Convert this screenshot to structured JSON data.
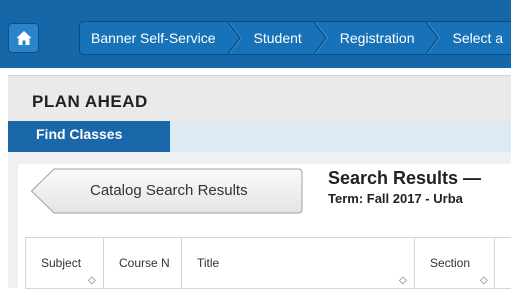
{
  "topbar": {
    "breadcrumbs": [
      "Banner Self-Service",
      "Student",
      "Registration",
      "Select a"
    ]
  },
  "page_title": "PLAN AHEAD",
  "tabs": [
    {
      "label": "Find Classes",
      "active": true
    }
  ],
  "back_button": {
    "label": "Catalog Search Results"
  },
  "results": {
    "title": "Search Results —",
    "term": "Term: Fall 2017 - Urba"
  },
  "table": {
    "headers": [
      "Subject",
      "Course N",
      "Title",
      "Section"
    ]
  },
  "colors": {
    "topbar": "#1667a8",
    "tab_active": "#1a67aa",
    "tabbar": "#dde9f3"
  }
}
